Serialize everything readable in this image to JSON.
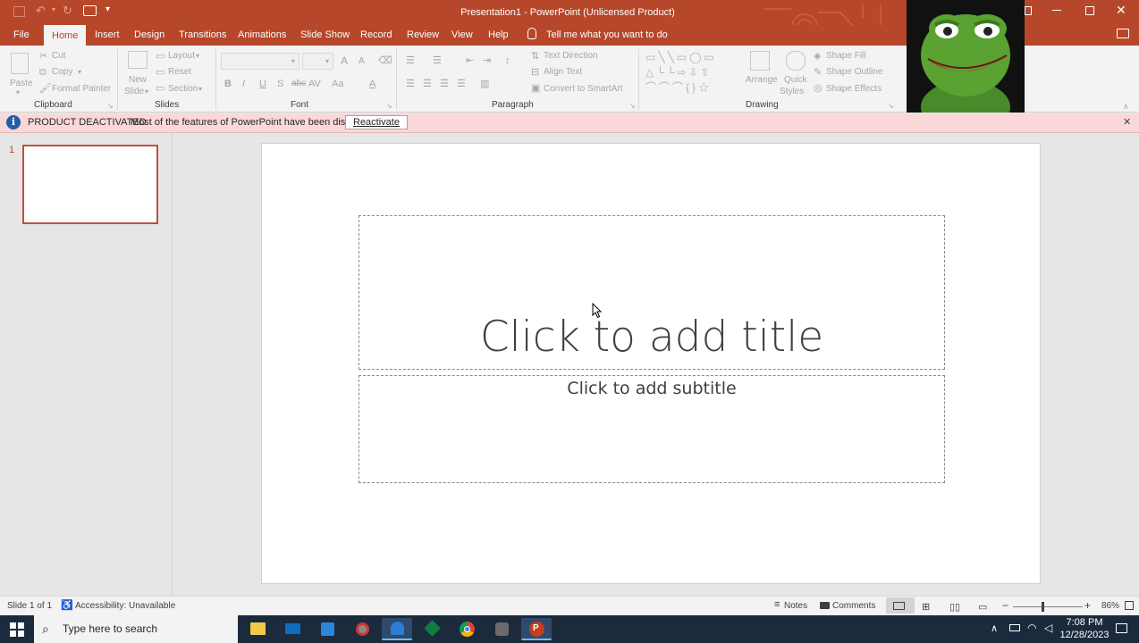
{
  "window": {
    "title": "Presentation1  -  PowerPoint (Unlicensed Product)"
  },
  "tabs": [
    {
      "label": "File"
    },
    {
      "label": "Home"
    },
    {
      "label": "Insert"
    },
    {
      "label": "Design"
    },
    {
      "label": "Transitions"
    },
    {
      "label": "Animations"
    },
    {
      "label": "Slide Show"
    },
    {
      "label": "Record"
    },
    {
      "label": "Review"
    },
    {
      "label": "View"
    },
    {
      "label": "Help"
    }
  ],
  "tell_me": "Tell me what you want to do",
  "ribbon": {
    "clipboard": {
      "paste": "Paste",
      "cut": "Cut",
      "copy": "Copy",
      "format_painter": "Format Painter",
      "label": "Clipboard"
    },
    "slides": {
      "new_slide_1": "New",
      "new_slide_2": "Slide",
      "layout": "Layout",
      "reset": "Reset",
      "section": "Section",
      "label": "Slides"
    },
    "font": {
      "label": "Font",
      "bold": "B",
      "italic": "I",
      "underline": "U",
      "strike": "S",
      "shadow": "abc",
      "spacing": "AV",
      "case": "Aa",
      "grow": "A",
      "shrink": "A",
      "color": "A"
    },
    "paragraph": {
      "label": "Paragraph",
      "text_direction": "Text Direction",
      "align_text": "Align Text",
      "convert_smartart": "Convert to SmartArt"
    },
    "drawing": {
      "label": "Drawing",
      "arrange": "Arrange",
      "quick_1": "Quick",
      "quick_2": "Styles",
      "shape_fill": "Shape Fill",
      "shape_outline": "Shape Outline",
      "shape_effects": "Shape Effects"
    }
  },
  "message_bar": {
    "title": "PRODUCT DEACTIVATED",
    "text": "Most of the features of PowerPoint have been disabled.",
    "button": "Reactivate"
  },
  "thumbnails": [
    {
      "number": "1"
    }
  ],
  "slide": {
    "title_placeholder": "Click to add title",
    "subtitle_placeholder": "Click to add subtitle"
  },
  "status": {
    "slide_count": "Slide 1 of 1",
    "accessibility": "Accessibility: Unavailable",
    "notes": "Notes",
    "comments": "Comments",
    "zoom": "86%",
    "zoom_level": 0.86
  },
  "taskbar": {
    "search_placeholder": "Type here to search",
    "time": "7:08 PM",
    "date": "12/28/2023"
  },
  "colors": {
    "accent": "#b7472a",
    "message_bg": "#fbd8d8",
    "taskbar": "#1c2a3d"
  }
}
